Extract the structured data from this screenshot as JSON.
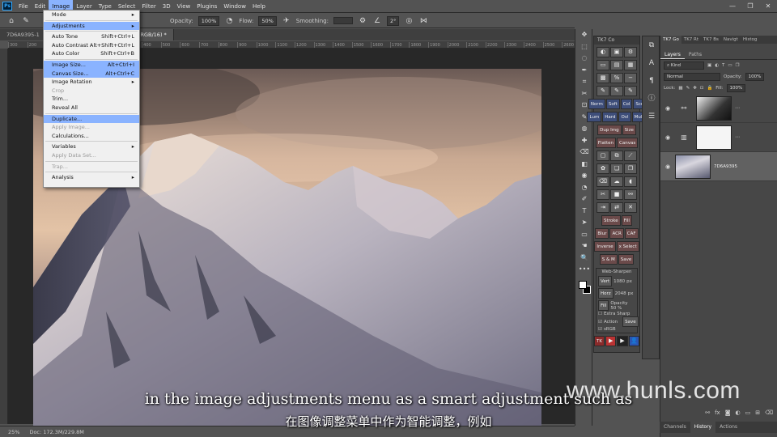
{
  "app": {
    "logo": "Ps"
  },
  "menubar": [
    "File",
    "Edit",
    "Image",
    "Layer",
    "Type",
    "Select",
    "Filter",
    "3D",
    "View",
    "Plugins",
    "Window",
    "Help"
  ],
  "window_controls": [
    "—",
    "❐",
    "✕"
  ],
  "options_bar": {
    "opacity_label": "Opacity:",
    "opacity": "100%",
    "flow_label": "Flow:",
    "flow": "50%",
    "smoothing_label": "Smoothing:",
    "angle": "2°"
  },
  "doc_tabs": [
    "7D6A9395-1",
    "0Z4A2865-1 @ 25% (0Z4A2865, RGB/16) *"
  ],
  "ruler_ticks": [
    "300",
    "200",
    "100",
    "0",
    "100",
    "200",
    "300",
    "400",
    "500",
    "600",
    "700",
    "800",
    "900",
    "1000",
    "1100",
    "1200",
    "1300",
    "1400",
    "1500",
    "1600",
    "1700",
    "1800",
    "1900",
    "2000",
    "2100",
    "2200",
    "2300",
    "2400",
    "2500",
    "2600",
    "2700",
    "2800",
    "2900"
  ],
  "status": {
    "zoom": "25%",
    "doc": "Doc: 172.3M/229.8M"
  },
  "image_menu": [
    {
      "label": "Mode",
      "shortcut": "▸",
      "state": "normal"
    },
    {
      "sep": true
    },
    {
      "label": "Adjustments",
      "shortcut": "▸",
      "state": "highlight"
    },
    {
      "sep": true
    },
    {
      "label": "Auto Tone",
      "shortcut": "Shift+Ctrl+L",
      "state": "normal"
    },
    {
      "label": "Auto Contrast",
      "shortcut": "Alt+Shift+Ctrl+L",
      "state": "normal"
    },
    {
      "label": "Auto Color",
      "shortcut": "Shift+Ctrl+B",
      "state": "normal"
    },
    {
      "sep": true
    },
    {
      "label": "Image Size...",
      "shortcut": "Alt+Ctrl+I",
      "state": "highlight"
    },
    {
      "label": "Canvas Size...",
      "shortcut": "Alt+Ctrl+C",
      "state": "highlight"
    },
    {
      "label": "Image Rotation",
      "shortcut": "▸",
      "state": "normal"
    },
    {
      "label": "Crop",
      "shortcut": "",
      "state": "disabled"
    },
    {
      "label": "Trim...",
      "shortcut": "",
      "state": "normal"
    },
    {
      "label": "Reveal All",
      "shortcut": "",
      "state": "normal"
    },
    {
      "sep": true
    },
    {
      "label": "Duplicate...",
      "shortcut": "",
      "state": "highlight"
    },
    {
      "label": "Apply Image...",
      "shortcut": "",
      "state": "disabled"
    },
    {
      "label": "Calculations...",
      "shortcut": "",
      "state": "normal"
    },
    {
      "sep": true
    },
    {
      "label": "Variables",
      "shortcut": "▸",
      "state": "normal"
    },
    {
      "label": "Apply Data Set...",
      "shortcut": "",
      "state": "disabled"
    },
    {
      "sep": true
    },
    {
      "label": "Trap...",
      "shortcut": "",
      "state": "disabled"
    },
    {
      "sep": true
    },
    {
      "label": "Analysis",
      "shortcut": "▸",
      "state": "normal"
    }
  ],
  "tools": [
    "✥",
    "⬚",
    "◌",
    "✒",
    "⌗",
    "✂",
    "⊡",
    "✎",
    "◍",
    "✚",
    "⌫",
    "◧",
    "◉",
    "◔",
    "✐",
    "T",
    "➤",
    "▭",
    "☚",
    "🔍",
    "•••"
  ],
  "tk_panel": {
    "title": "TK7 Co",
    "rows": [
      [
        "Norm",
        "Soft",
        "Col",
        "Scr"
      ],
      [
        "Lum",
        "Hard",
        "Ovl",
        "Mult"
      ],
      [
        "Dup Img",
        "Size"
      ],
      [
        "Flatten",
        "Canvas"
      ],
      [
        "Stroke",
        "Fill"
      ],
      [
        "Blur",
        "ACR",
        "CAF"
      ],
      [
        "Inverse",
        "x Select"
      ],
      [
        "S & M",
        "Save"
      ]
    ],
    "web_sharpen": {
      "title": "Web-Sharpen",
      "vert_label": "Vert",
      "vert": "1080",
      "horz_label": "Horz",
      "horz": "2048",
      "unit": "px",
      "fill_label": "Fill",
      "opacity_label": "Opacity",
      "opacity": "50",
      "pct": "%",
      "extra_sharp": "Extra Sharp",
      "action": "Action",
      "srgb": "sRGB",
      "save": "Save"
    },
    "footer": "TK"
  },
  "panel_tabs": [
    "TK7 Go",
    "TK7 Rt",
    "TK7 Bs",
    "Navigt",
    "Histog"
  ],
  "layers_tabs": [
    "Layers",
    "Paths"
  ],
  "layers_controls": {
    "kind": "Kind",
    "blend": "Normal",
    "opacity_label": "Opacity:",
    "opacity": "100%",
    "lock_label": "Lock:",
    "fill_label": "Fill:",
    "fill": "100%"
  },
  "layers": [
    {
      "name": "",
      "type": "adjustment-bw"
    },
    {
      "name": "",
      "type": "levels-mask"
    },
    {
      "name": "7D6A9395",
      "type": "image"
    }
  ],
  "bottom_tabs": [
    "Channels",
    "History",
    "Actions"
  ],
  "subtitle_en": "in the image adjustments menu as a smart adjustment such as",
  "subtitle_zh": "在图像调整菜单中作为智能调整，例如",
  "watermark": "www.hunls.com"
}
